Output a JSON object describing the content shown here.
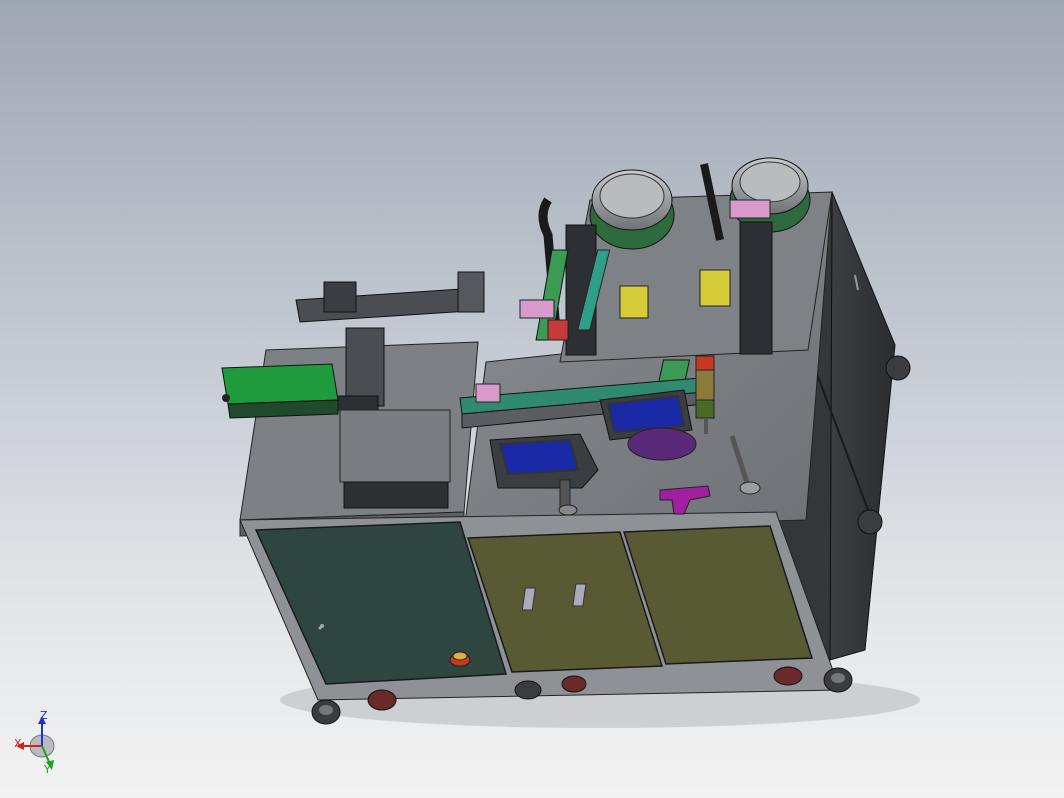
{
  "viewport": {
    "background_top": "#9ea7b3",
    "background_bottom": "#f2f2f2"
  },
  "triad": {
    "x_label": "X",
    "y_label": "Y",
    "z_label": "Z",
    "x_color": "#d42020",
    "y_color": "#20a020",
    "z_color": "#2030d0"
  },
  "model": {
    "cabinet_left_color": "#2f4540",
    "cabinet_right_color": "#585a34",
    "frame_color": "#8e9196",
    "top_plate_color": "#7b7f83",
    "conveyor_color": "#1f9a3c",
    "bowl_color": "#8a8d90",
    "fixture_pink_color": "#d79acb",
    "fixture_yellow_color": "#d6cc3a",
    "screen_color": "#1a2aa6",
    "magenta_part_color": "#a020a0",
    "estop_color": "#c83a1e"
  }
}
